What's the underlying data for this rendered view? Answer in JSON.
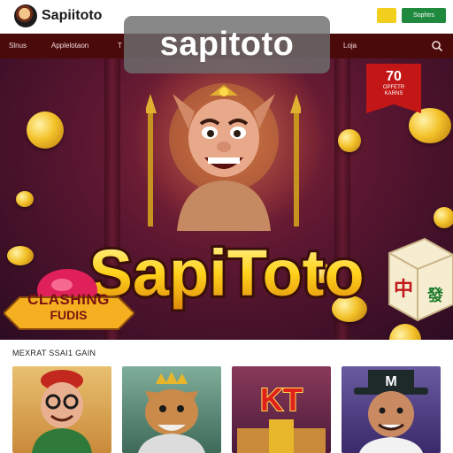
{
  "header": {
    "site_name": "Sapiitoto",
    "login_button": "",
    "register_button": "Sophtrs"
  },
  "nav": {
    "items": [
      "Slnus",
      "Applelotaon",
      "T",
      "Loja"
    ]
  },
  "watermark": "sapitoto",
  "hero": {
    "title": "SapiToto",
    "promo_number": "70",
    "promo_line1": "OPFETR",
    "promo_line2": "KARNS",
    "badge_line1": "CLASHING",
    "badge_line2": "FUDIS"
  },
  "games_section": {
    "title": "MEXRAT SSAI1 GAIN",
    "cards": [
      {
        "name": "game-card-1",
        "text": ""
      },
      {
        "name": "game-card-2",
        "text": ""
      },
      {
        "name": "game-card-3",
        "text": "KT"
      },
      {
        "name": "game-card-4",
        "text": "M"
      }
    ]
  },
  "colors": {
    "nav_bg": "#4a0a0a",
    "hero_bg": "#5a1630",
    "gold": "#f3c22a",
    "register_green": "#1f8a3e",
    "login_yellow": "#f2cf1d"
  }
}
